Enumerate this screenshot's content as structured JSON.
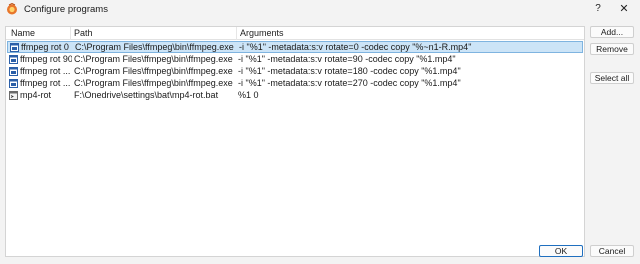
{
  "window": {
    "title": "Configure programs",
    "help_label": "?",
    "close_label": "✕"
  },
  "columns": [
    "Name",
    "Path",
    "Arguments"
  ],
  "rows": [
    {
      "name": "ffmpeg rot 0",
      "path": "C:\\Program Files\\ffmpeg\\bin\\ffmpeg.exe",
      "args": "-i \"%1\" -metadata:s:v rotate=0 -codec copy  \"%~n1-R.mp4\"",
      "icon": "window-icon",
      "selected": true
    },
    {
      "name": "ffmpeg rot 90",
      "path": "C:\\Program Files\\ffmpeg\\bin\\ffmpeg.exe",
      "args": "-i \"%1\" -metadata:s:v rotate=90 -codec copy \"%1.mp4\"",
      "icon": "window-icon",
      "selected": false
    },
    {
      "name": "ffmpeg rot ...",
      "path": "C:\\Program Files\\ffmpeg\\bin\\ffmpeg.exe",
      "args": "-i \"%1\" -metadata:s:v rotate=180 -codec copy \"%1.mp4\"",
      "icon": "window-icon",
      "selected": false
    },
    {
      "name": "ffmpeg rot ...",
      "path": "C:\\Program Files\\ffmpeg\\bin\\ffmpeg.exe",
      "args": "-i \"%1\" -metadata:s:v rotate=270 -codec copy \"%1.mp4\"",
      "icon": "window-icon",
      "selected": false
    },
    {
      "name": "mp4-rot",
      "path": "F:\\Onedrive\\settings\\bat\\mp4-rot.bat",
      "args": "%1 0",
      "icon": "batch-file-icon",
      "selected": false
    }
  ],
  "buttons": {
    "add": "Add...",
    "remove": "Remove",
    "select_all": "Select all",
    "ok": "OK",
    "cancel": "Cancel"
  },
  "colors": {
    "selection": "#cce4f7",
    "selection_border": "#7fb4e0",
    "accent": "#1f6fbf"
  }
}
